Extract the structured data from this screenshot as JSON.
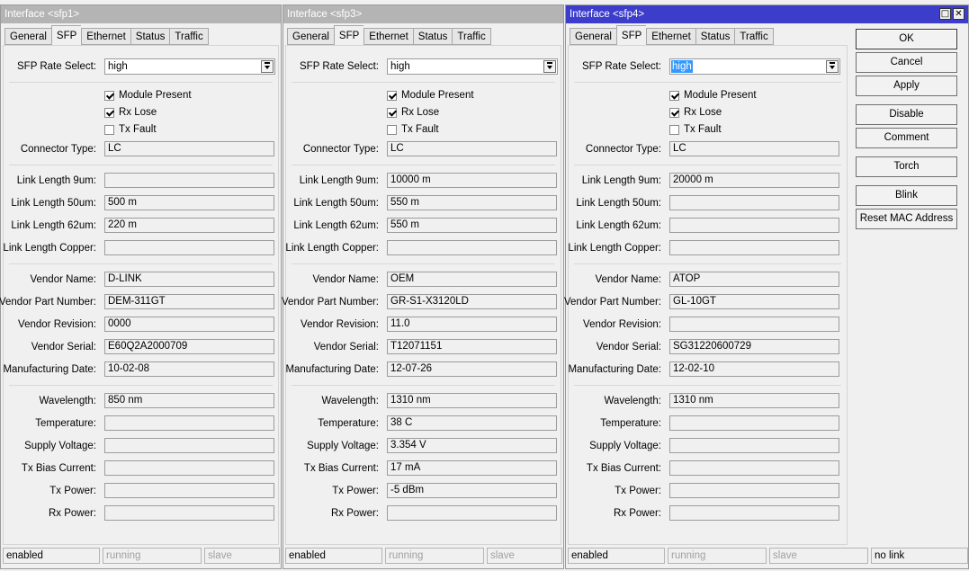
{
  "tab_labels": [
    "General",
    "SFP",
    "Ethernet",
    "Status",
    "Traffic"
  ],
  "labels": {
    "rate_select": "SFP Rate Select:",
    "module_present": "Module Present",
    "rx_lose": "Rx Lose",
    "tx_fault": "Tx Fault",
    "connector_type": "Connector Type:",
    "link_9um": "Link Length 9um:",
    "link_50um": "Link Length 50um:",
    "link_62um": "Link Length 62um:",
    "link_copper": "Link Length Copper:",
    "vendor_name": "Vendor Name:",
    "vendor_part": "Vendor Part Number:",
    "vendor_rev": "Vendor Revision:",
    "vendor_serial": "Vendor Serial:",
    "mfg_date": "Manufacturing Date:",
    "wavelength": "Wavelength:",
    "temperature": "Temperature:",
    "supply_voltage": "Supply Voltage:",
    "tx_bias": "Tx Bias Current:",
    "tx_power": "Tx Power:",
    "rx_power": "Rx Power:"
  },
  "windows": [
    {
      "title": "Interface <sfp1>",
      "rate_select": "high",
      "module_present": true,
      "rx_lose": true,
      "tx_fault": false,
      "connector_type": "LC",
      "link_9um": "",
      "link_50um": "500 m",
      "link_62um": "220 m",
      "link_copper": "",
      "vendor_name": "D-LINK",
      "vendor_part": "DEM-311GT",
      "vendor_rev": "0000",
      "vendor_serial": "E60Q2A2000709",
      "mfg_date": "10-02-08",
      "wavelength": "850 nm",
      "temperature": "",
      "supply_voltage": "",
      "tx_bias": "",
      "tx_power": "",
      "rx_power": "",
      "status": {
        "enabled": "enabled",
        "running": "running",
        "slave": "slave"
      }
    },
    {
      "title": "Interface <sfp3>",
      "rate_select": "high",
      "module_present": true,
      "rx_lose": true,
      "tx_fault": false,
      "connector_type": "LC",
      "link_9um": "10000 m",
      "link_50um": "550 m",
      "link_62um": "550 m",
      "link_copper": "",
      "vendor_name": "OEM",
      "vendor_part": "GR-S1-X3120LD",
      "vendor_rev": "11.0",
      "vendor_serial": "T12071151",
      "mfg_date": "12-07-26",
      "wavelength": "1310 nm",
      "temperature": "38 C",
      "supply_voltage": "3.354 V",
      "tx_bias": "17 mA",
      "tx_power": "-5 dBm",
      "rx_power": "",
      "status": {
        "enabled": "enabled",
        "running": "running",
        "slave": "slave"
      }
    },
    {
      "title": "Interface <sfp4>",
      "rate_select": "high",
      "module_present": true,
      "rx_lose": true,
      "tx_fault": false,
      "connector_type": "LC",
      "link_9um": "20000 m",
      "link_50um": "",
      "link_62um": "",
      "link_copper": "",
      "vendor_name": "ATOP",
      "vendor_part": "GL-10GT",
      "vendor_rev": "",
      "vendor_serial": "SG31220600729",
      "mfg_date": "12-02-10",
      "wavelength": "1310 nm",
      "temperature": "",
      "supply_voltage": "",
      "tx_bias": "",
      "tx_power": "",
      "rx_power": "",
      "status": {
        "enabled": "enabled",
        "running": "running",
        "slave": "slave",
        "link": "no link"
      }
    }
  ],
  "buttons": [
    "OK",
    "Cancel",
    "Apply",
    "Disable",
    "Comment",
    "Torch",
    "Blink",
    "Reset MAC Address"
  ],
  "colors": {
    "active_title": "#3d3dcb",
    "inactive_title": "#b4b4b4",
    "selection": "#3399ff"
  }
}
